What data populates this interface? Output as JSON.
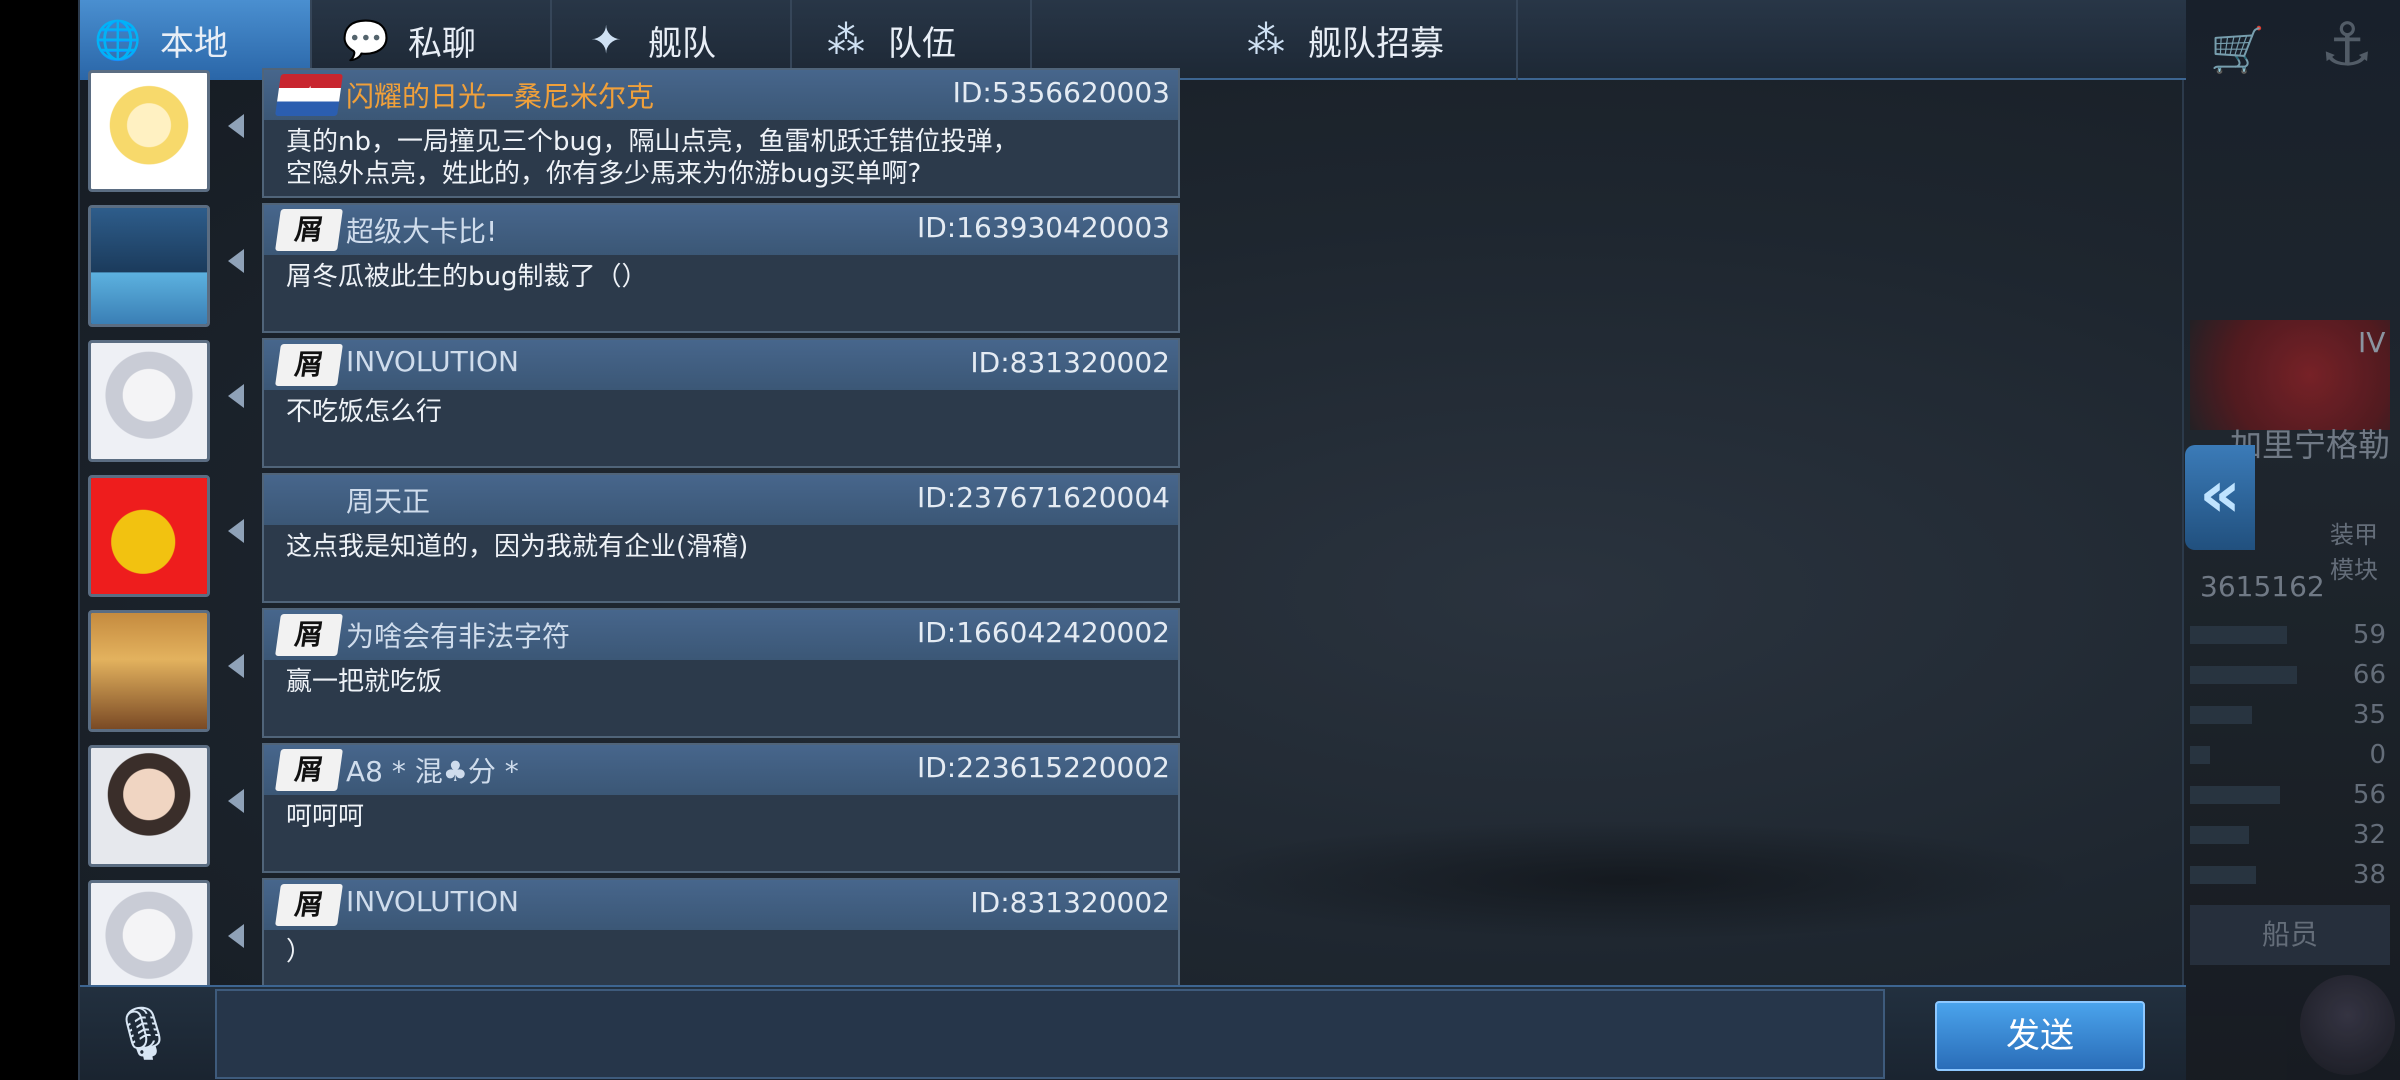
{
  "tabs": [
    {
      "label": "本地",
      "icon": "globe-icon",
      "active": true
    },
    {
      "label": "私聊",
      "icon": "chat-bubble-icon",
      "active": false
    },
    {
      "label": "舰队",
      "icon": "fleet-icon",
      "active": false
    },
    {
      "label": "队伍",
      "icon": "team-icon",
      "active": false
    },
    {
      "label": "舰队招募",
      "icon": "recruit-icon",
      "active": false
    }
  ],
  "messages": [
    {
      "badge": "",
      "badge_type": "flag",
      "name": "闪耀的日光一桑尼米尔克",
      "name_color": "#f0a03a",
      "id": "ID:5356620003",
      "text": "真的nb，一局撞见三个bug，隔山点亮，鱼雷机跃迁错位投弹，\n空隐外点亮，姓此的，你有多少馬来为你游bug买单啊?",
      "avatar": "anime-girl-avatar"
    },
    {
      "badge": "屑",
      "badge_type": "tag",
      "name": "超级大卡比!",
      "id": "ID:163930420003",
      "text": "屑冬瓜被此生的bug制裁了（）",
      "avatar": "warship-avatar"
    },
    {
      "badge": "屑",
      "badge_type": "tag",
      "name": "INVOLUTION",
      "id": "ID:831320002",
      "text": "不吃饭怎么行",
      "avatar": "silver-hair-girl-avatar"
    },
    {
      "badge": "",
      "badge_type": "none",
      "name": "周天正",
      "id": "ID:237671620004",
      "text": "这点我是知道的，因为我就有企业(滑稽)",
      "avatar": "red-flag-avatar"
    },
    {
      "badge": "屑",
      "badge_type": "tag",
      "name": "为啥会有非法字符",
      "id": "ID:166042420002",
      "text": "赢一把就吃饭",
      "avatar": "wolf-girl-avatar"
    },
    {
      "badge": "屑",
      "badge_type": "tag",
      "name": "A8 * 混♣分 *",
      "id": "ID:223615220002",
      "text": "呵呵呵",
      "avatar": "boy-photo-avatar"
    },
    {
      "badge": "屑",
      "badge_type": "tag",
      "name": "INVOLUTION",
      "id": "ID:831320002",
      "text": "）",
      "avatar": "silver-hair-girl-avatar"
    }
  ],
  "input": {
    "value": "",
    "placeholder": ""
  },
  "send_label": "发送",
  "right_panel": {
    "tier": "IV",
    "ship_name": "加里宁格勒",
    "mods_label": "装甲 模块",
    "number": "3615162",
    "stats": [
      "59",
      "66",
      "35",
      "0",
      "56",
      "32",
      "38"
    ],
    "stat_fill": [
      0.55,
      0.62,
      0.3,
      0.0,
      0.5,
      0.28,
      0.33
    ],
    "crew_label": "船员"
  },
  "colors": {
    "accent": "#2a66a8",
    "name_highlight": "#f0a03a",
    "panel_bg": "#1e262f"
  }
}
